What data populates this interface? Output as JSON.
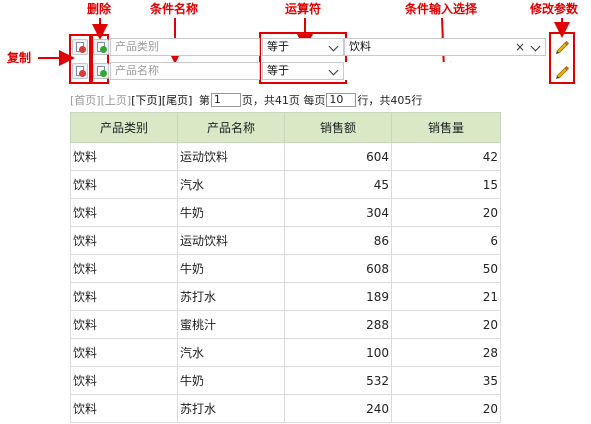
{
  "annotations": {
    "copy": "复制",
    "delete": "删除",
    "condition_name": "条件名称",
    "operator": "运算符",
    "condition_input": "条件输入选择",
    "modify_params": "修改参数"
  },
  "filters": {
    "rows": [
      {
        "name_placeholder": "产品类别",
        "operator": "等于",
        "value": "饮料",
        "clear": "×"
      },
      {
        "name_placeholder": "产品名称",
        "operator": "等于",
        "value": ""
      }
    ]
  },
  "pager": {
    "first": "[首页]",
    "prev": "[上页]",
    "next": "[下页]",
    "last": "[尾页]",
    "page_prefix": "第",
    "page_value": "1",
    "page_suffix": "页，共41页 每页",
    "size_value": "10",
    "size_suffix": "行，共405行"
  },
  "table": {
    "headers": [
      "产品类别",
      "产品名称",
      "销售额",
      "销售量"
    ],
    "rows": [
      [
        "饮料",
        "运动饮料",
        "604",
        "42"
      ],
      [
        "饮料",
        "汽水",
        "45",
        "15"
      ],
      [
        "饮料",
        "牛奶",
        "304",
        "20"
      ],
      [
        "饮料",
        "运动饮料",
        "86",
        "6"
      ],
      [
        "饮料",
        "牛奶",
        "608",
        "50"
      ],
      [
        "饮料",
        "苏打水",
        "189",
        "21"
      ],
      [
        "饮料",
        "蜜桃汁",
        "288",
        "20"
      ],
      [
        "饮料",
        "汽水",
        "100",
        "28"
      ],
      [
        "饮料",
        "牛奶",
        "532",
        "35"
      ],
      [
        "饮料",
        "苏打水",
        "240",
        "20"
      ]
    ]
  },
  "colors": {
    "annotation": "#e00000",
    "header_bg": "#d9e8c6"
  }
}
